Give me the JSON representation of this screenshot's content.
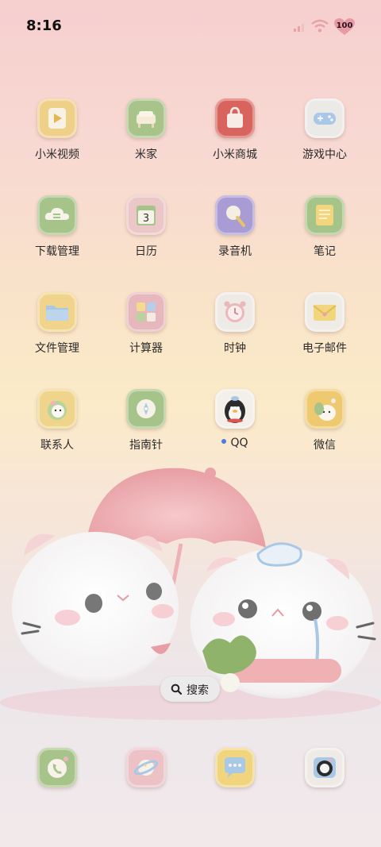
{
  "status": {
    "time": "8:16",
    "battery": "100"
  },
  "apps": [
    {
      "label": "小米视频",
      "icon": "video-icon"
    },
    {
      "label": "米家",
      "icon": "home-icon"
    },
    {
      "label": "小米商城",
      "icon": "shop-icon"
    },
    {
      "label": "游戏中心",
      "icon": "gamepad-icon"
    },
    {
      "label": "下载管理",
      "icon": "download-cloud-icon"
    },
    {
      "label": "日历",
      "icon": "calendar-icon",
      "day": "3"
    },
    {
      "label": "录音机",
      "icon": "recorder-icon"
    },
    {
      "label": "笔记",
      "icon": "notes-icon"
    },
    {
      "label": "文件管理",
      "icon": "folder-icon"
    },
    {
      "label": "计算器",
      "icon": "calculator-icon"
    },
    {
      "label": "时钟",
      "icon": "clock-icon"
    },
    {
      "label": "电子邮件",
      "icon": "mail-icon"
    },
    {
      "label": "联系人",
      "icon": "contacts-icon"
    },
    {
      "label": "指南针",
      "icon": "compass-icon"
    },
    {
      "label": "QQ",
      "icon": "qq-penguin-icon",
      "new": true
    },
    {
      "label": "微信",
      "icon": "wechat-icon"
    }
  ],
  "dock": [
    {
      "icon": "phone-icon"
    },
    {
      "icon": "planet-icon"
    },
    {
      "icon": "message-icon"
    },
    {
      "icon": "camera-icon"
    }
  ],
  "search": {
    "label": "搜索"
  },
  "colors": {
    "accent": "#4a7be0"
  }
}
